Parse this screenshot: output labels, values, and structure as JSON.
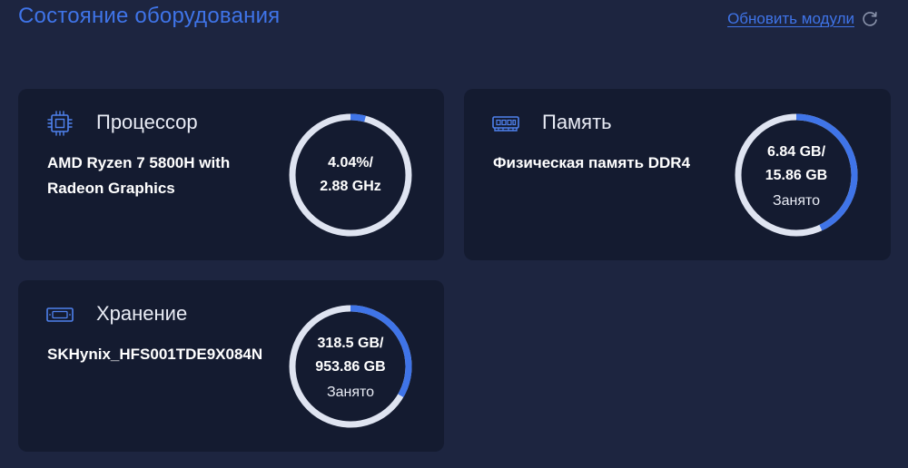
{
  "header": {
    "title": "Состояние оборудования",
    "refresh_label": "Обновить модули"
  },
  "colors": {
    "background": "#1d2540",
    "card": "#141b30",
    "accent": "#3f74e8",
    "track": "#dfe4f1"
  },
  "cards": {
    "cpu": {
      "title": "Процессор",
      "icon": "cpu-icon",
      "detail": "AMD Ryzen 7 5800H with Radeon Graphics",
      "gauge_line1": "4.04%/",
      "gauge_line2": "2.88 GHz",
      "usage_fraction": 0.0404
    },
    "memory": {
      "title": "Память",
      "icon": "memory-icon",
      "detail": "Физическая память DDR4",
      "gauge_line1": "6.84 GB/",
      "gauge_line2": "15.86 GB",
      "gauge_caption": "Занято",
      "usage_fraction": 0.431
    },
    "storage": {
      "title": "Хранение",
      "icon": "storage-icon",
      "detail": "SKHynix_HFS001TDE9X084N",
      "gauge_line1": "318.5 GB/",
      "gauge_line2": "953.86 GB",
      "gauge_caption": "Занято",
      "usage_fraction": 0.334
    }
  }
}
